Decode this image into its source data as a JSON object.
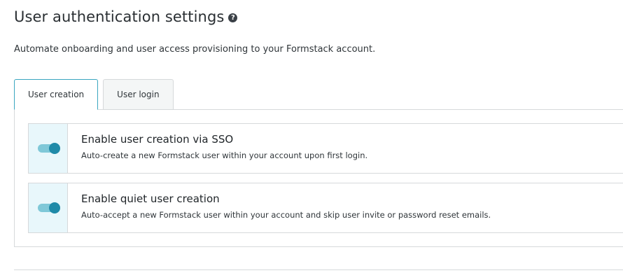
{
  "header": {
    "title": "User authentication settings",
    "help_icon": "question-circle-icon",
    "subtitle": "Automate onboarding and user access provisioning to your Formstack account."
  },
  "tabs": [
    {
      "label": "User creation",
      "active": true
    },
    {
      "label": "User login",
      "active": false
    }
  ],
  "settings": [
    {
      "title": "Enable user creation via SSO",
      "description": "Auto-create a new Formstack user within your account upon first login.",
      "enabled": true
    },
    {
      "title": "Enable quiet user creation",
      "description": "Auto-accept a new Formstack user within your account and skip user invite or password reset emails.",
      "enabled": true
    }
  ],
  "colors": {
    "accent": "#1f8aa8",
    "toggle_track": "#7fc8d8",
    "toggle_cell_bg": "#e8f7fb",
    "active_tab_border": "#3aa6bf",
    "border": "#d6d9db"
  }
}
